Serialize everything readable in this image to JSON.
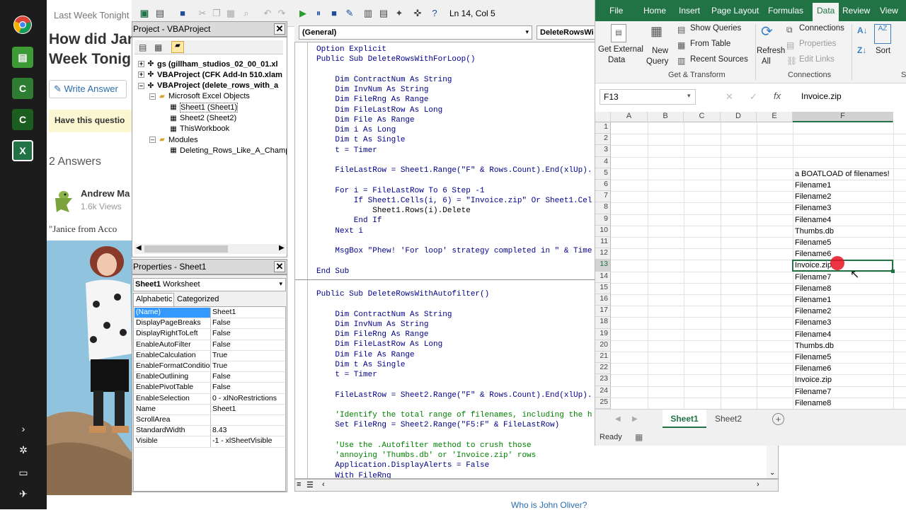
{
  "taskbar": {
    "icons": [
      "chrome-icon",
      "notepad-icon",
      "camtasia-icon",
      "camtasia-recorder-icon",
      "excel-icon"
    ],
    "bottom_icons": [
      "chevron-right-icon",
      "settings-icon",
      "battery-icon",
      "airplane-icon"
    ]
  },
  "web": {
    "tab_title": "Last Week Tonight",
    "question_line1": "How did Jan",
    "question_line2": "Week Tonig",
    "write_answer": "Write Answer",
    "have_question": "Have this questio",
    "answers_count": "2 Answers",
    "answerer_name": "Andrew Ma",
    "answerer_views": "1.6k Views",
    "answer_snippet": "\"Janice from Acco",
    "bottom_link": "Who is John Oliver?"
  },
  "vbe": {
    "position": "Ln 14, Col 5",
    "project_title": "Project - VBAProject",
    "tree": [
      {
        "label": "gs (gillham_studios_02_00_01.xl",
        "bold": true,
        "indent": 0
      },
      {
        "label": "VBAProject (CFK Add-In 510.xlam",
        "bold": true,
        "indent": 0
      },
      {
        "label": "VBAProject (delete_rows_with_a",
        "bold": true,
        "indent": 0
      },
      {
        "label": "Microsoft Excel Objects",
        "bold": false,
        "indent": 1
      },
      {
        "label": "Sheet1 (Sheet1)",
        "bold": false,
        "indent": 2
      },
      {
        "label": "Sheet2 (Sheet2)",
        "bold": false,
        "indent": 2
      },
      {
        "label": "ThisWorkbook",
        "bold": false,
        "indent": 2
      },
      {
        "label": "Modules",
        "bold": false,
        "indent": 1
      },
      {
        "label": "Deleting_Rows_Like_A_Champ",
        "bold": false,
        "indent": 2
      }
    ],
    "props_title": "Properties - Sheet1",
    "props_object": "Sheet1",
    "props_object_type": "Worksheet",
    "props_tab_alpha": "Alphabetic",
    "props_tab_cat": "Categorized",
    "props": [
      [
        "(Name)",
        "Sheet1"
      ],
      [
        "DisplayPageBreaks",
        "False"
      ],
      [
        "DisplayRightToLeft",
        "False"
      ],
      [
        "EnableAutoFilter",
        "False"
      ],
      [
        "EnableCalculation",
        "True"
      ],
      [
        "EnableFormatConditions",
        "True"
      ],
      [
        "EnableOutlining",
        "False"
      ],
      [
        "EnablePivotTable",
        "False"
      ],
      [
        "EnableSelection",
        "0 - xlNoRestrictions"
      ],
      [
        "Name",
        "Sheet1"
      ],
      [
        "ScrollArea",
        ""
      ],
      [
        "StandardWidth",
        "8.43"
      ],
      [
        "Visible",
        "-1 - xlSheetVisible"
      ]
    ],
    "combo_general": "(General)",
    "combo_proc": "DeleteRowsWi",
    "code_block1": [
      "Option Explicit",
      "Public Sub DeleteRowsWithForLoop()",
      "",
      "    Dim ContractNum As String",
      "    Dim InvNum As String",
      "    Dim FileRng As Range",
      "    Dim FileLastRow As Long",
      "    Dim File As Range",
      "    Dim i As Long",
      "    Dim t As Single",
      "    t = Timer",
      "",
      "    FileLastRow = Sheet1.Range(\"F\" & Rows.Count).End(xlUp).",
      "",
      "    For i = FileLastRow To 6 Step -1",
      "        If Sheet1.Cells(i, 6) = \"Invoice.zip\" Or Sheet1.Cel",
      "            Sheet1.Rows(i).Delete",
      "        End If",
      "    Next i",
      "",
      "    MsgBox \"Phew! 'For loop' strategy completed in \" & Time",
      "",
      "End Sub"
    ],
    "code_block2": [
      "Public Sub DeleteRowsWithAutofilter()",
      "",
      "    Dim ContractNum As String",
      "    Dim InvNum As String",
      "    Dim FileRng As Range",
      "    Dim FileLastRow As Long",
      "    Dim File As Range",
      "    Dim t As Single",
      "    t = Timer",
      "",
      "    FileLastRow = Sheet2.Range(\"F\" & Rows.Count).End(xlUp).",
      "",
      "    'Identify the total range of filenames, including the h",
      "    Set FileRng = Sheet2.Range(\"F5:F\" & FileLastRow)",
      "",
      "    'Use the .Autofilter method to crush those",
      "    'annoying 'Thumbs.db' or 'Invoice.zip' rows",
      "    Application.DisplayAlerts = False",
      "    With FileRng"
    ]
  },
  "excel": {
    "tabs": [
      "File",
      "Home",
      "Insert",
      "Page Layout",
      "Formulas",
      "Data",
      "Review",
      "View"
    ],
    "active_tab": "Data",
    "ribbon": {
      "get_external": "Get External",
      "data_lbl": "Data",
      "new_query": "New",
      "query_lbl": "Query",
      "show_queries": "Show Queries",
      "from_table": "From Table",
      "recent_sources": "Recent Sources",
      "group_get": "Get & Transform",
      "refresh": "Refresh",
      "all": "All",
      "connections": "Connections",
      "properties": "Properties",
      "edit_links": "Edit Links",
      "group_conn": "Connections",
      "sort": "Sort",
      "group_sort": "S"
    },
    "name_box": "F13",
    "formula": "Invoice.zip",
    "columns": [
      "A",
      "B",
      "C",
      "D",
      "E",
      "F"
    ],
    "rows": [
      "1",
      "2",
      "3",
      "4",
      "5",
      "6",
      "7",
      "8",
      "9",
      "10",
      "11",
      "12",
      "13",
      "14",
      "15",
      "16",
      "17",
      "18",
      "19",
      "20",
      "21",
      "22",
      "23",
      "24",
      "25"
    ],
    "colF": [
      "",
      "",
      "",
      "",
      "a BOATLOAD of filenames!",
      "Filename1",
      "Filename2",
      "Filename3",
      "Filename4",
      "Thumbs.db",
      "Filename5",
      "Filename6",
      "Invoice.zip",
      "Filename7",
      "Filename8",
      "Filename1",
      "Filename2",
      "Filename3",
      "Filename4",
      "Thumbs.db",
      "Filename5",
      "Filename6",
      "Invoice.zip",
      "Filename7",
      "Filename8"
    ],
    "sheets": [
      "Sheet1",
      "Sheet2"
    ],
    "active_sheet": "Sheet1",
    "status": "Ready",
    "colors": {
      "accent": "#217346",
      "selection": "#217346",
      "highlight": "#e81123"
    }
  }
}
